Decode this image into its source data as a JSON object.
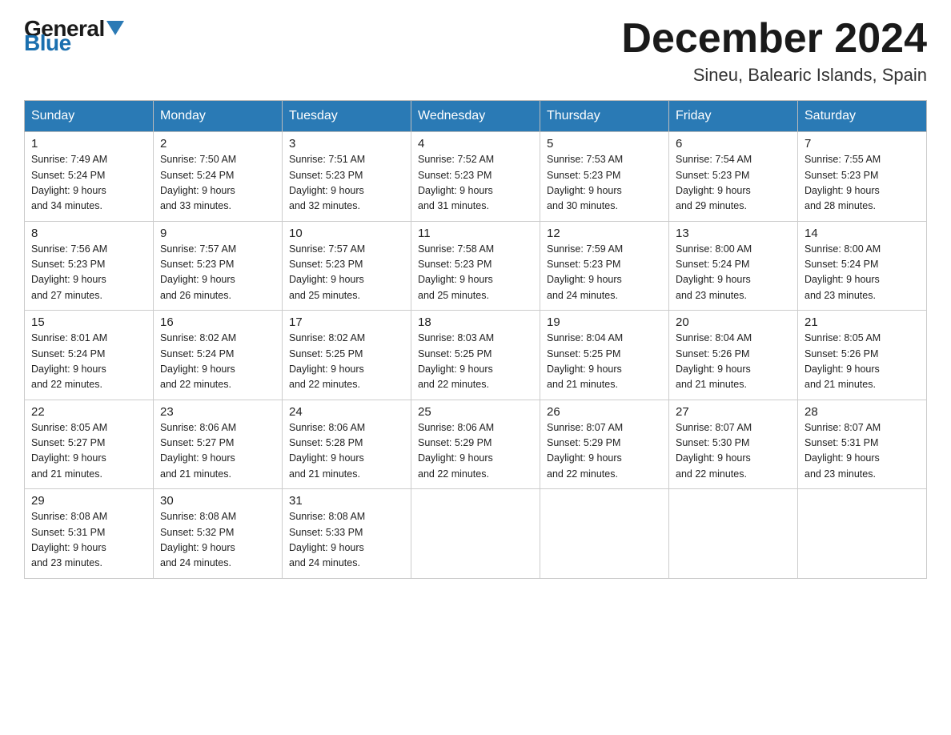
{
  "header": {
    "logo_general": "General",
    "logo_blue": "Blue",
    "month_title": "December 2024",
    "location": "Sineu, Balearic Islands, Spain"
  },
  "weekdays": [
    "Sunday",
    "Monday",
    "Tuesday",
    "Wednesday",
    "Thursday",
    "Friday",
    "Saturday"
  ],
  "weeks": [
    [
      {
        "day": "1",
        "sunrise": "7:49 AM",
        "sunset": "5:24 PM",
        "daylight": "9 hours and 34 minutes."
      },
      {
        "day": "2",
        "sunrise": "7:50 AM",
        "sunset": "5:24 PM",
        "daylight": "9 hours and 33 minutes."
      },
      {
        "day": "3",
        "sunrise": "7:51 AM",
        "sunset": "5:23 PM",
        "daylight": "9 hours and 32 minutes."
      },
      {
        "day": "4",
        "sunrise": "7:52 AM",
        "sunset": "5:23 PM",
        "daylight": "9 hours and 31 minutes."
      },
      {
        "day": "5",
        "sunrise": "7:53 AM",
        "sunset": "5:23 PM",
        "daylight": "9 hours and 30 minutes."
      },
      {
        "day": "6",
        "sunrise": "7:54 AM",
        "sunset": "5:23 PM",
        "daylight": "9 hours and 29 minutes."
      },
      {
        "day": "7",
        "sunrise": "7:55 AM",
        "sunset": "5:23 PM",
        "daylight": "9 hours and 28 minutes."
      }
    ],
    [
      {
        "day": "8",
        "sunrise": "7:56 AM",
        "sunset": "5:23 PM",
        "daylight": "9 hours and 27 minutes."
      },
      {
        "day": "9",
        "sunrise": "7:57 AM",
        "sunset": "5:23 PM",
        "daylight": "9 hours and 26 minutes."
      },
      {
        "day": "10",
        "sunrise": "7:57 AM",
        "sunset": "5:23 PM",
        "daylight": "9 hours and 25 minutes."
      },
      {
        "day": "11",
        "sunrise": "7:58 AM",
        "sunset": "5:23 PM",
        "daylight": "9 hours and 25 minutes."
      },
      {
        "day": "12",
        "sunrise": "7:59 AM",
        "sunset": "5:23 PM",
        "daylight": "9 hours and 24 minutes."
      },
      {
        "day": "13",
        "sunrise": "8:00 AM",
        "sunset": "5:24 PM",
        "daylight": "9 hours and 23 minutes."
      },
      {
        "day": "14",
        "sunrise": "8:00 AM",
        "sunset": "5:24 PM",
        "daylight": "9 hours and 23 minutes."
      }
    ],
    [
      {
        "day": "15",
        "sunrise": "8:01 AM",
        "sunset": "5:24 PM",
        "daylight": "9 hours and 22 minutes."
      },
      {
        "day": "16",
        "sunrise": "8:02 AM",
        "sunset": "5:24 PM",
        "daylight": "9 hours and 22 minutes."
      },
      {
        "day": "17",
        "sunrise": "8:02 AM",
        "sunset": "5:25 PM",
        "daylight": "9 hours and 22 minutes."
      },
      {
        "day": "18",
        "sunrise": "8:03 AM",
        "sunset": "5:25 PM",
        "daylight": "9 hours and 22 minutes."
      },
      {
        "day": "19",
        "sunrise": "8:04 AM",
        "sunset": "5:25 PM",
        "daylight": "9 hours and 21 minutes."
      },
      {
        "day": "20",
        "sunrise": "8:04 AM",
        "sunset": "5:26 PM",
        "daylight": "9 hours and 21 minutes."
      },
      {
        "day": "21",
        "sunrise": "8:05 AM",
        "sunset": "5:26 PM",
        "daylight": "9 hours and 21 minutes."
      }
    ],
    [
      {
        "day": "22",
        "sunrise": "8:05 AM",
        "sunset": "5:27 PM",
        "daylight": "9 hours and 21 minutes."
      },
      {
        "day": "23",
        "sunrise": "8:06 AM",
        "sunset": "5:27 PM",
        "daylight": "9 hours and 21 minutes."
      },
      {
        "day": "24",
        "sunrise": "8:06 AM",
        "sunset": "5:28 PM",
        "daylight": "9 hours and 21 minutes."
      },
      {
        "day": "25",
        "sunrise": "8:06 AM",
        "sunset": "5:29 PM",
        "daylight": "9 hours and 22 minutes."
      },
      {
        "day": "26",
        "sunrise": "8:07 AM",
        "sunset": "5:29 PM",
        "daylight": "9 hours and 22 minutes."
      },
      {
        "day": "27",
        "sunrise": "8:07 AM",
        "sunset": "5:30 PM",
        "daylight": "9 hours and 22 minutes."
      },
      {
        "day": "28",
        "sunrise": "8:07 AM",
        "sunset": "5:31 PM",
        "daylight": "9 hours and 23 minutes."
      }
    ],
    [
      {
        "day": "29",
        "sunrise": "8:08 AM",
        "sunset": "5:31 PM",
        "daylight": "9 hours and 23 minutes."
      },
      {
        "day": "30",
        "sunrise": "8:08 AM",
        "sunset": "5:32 PM",
        "daylight": "9 hours and 24 minutes."
      },
      {
        "day": "31",
        "sunrise": "8:08 AM",
        "sunset": "5:33 PM",
        "daylight": "9 hours and 24 minutes."
      },
      null,
      null,
      null,
      null
    ]
  ],
  "labels": {
    "sunrise": "Sunrise:",
    "sunset": "Sunset:",
    "daylight": "Daylight:"
  }
}
